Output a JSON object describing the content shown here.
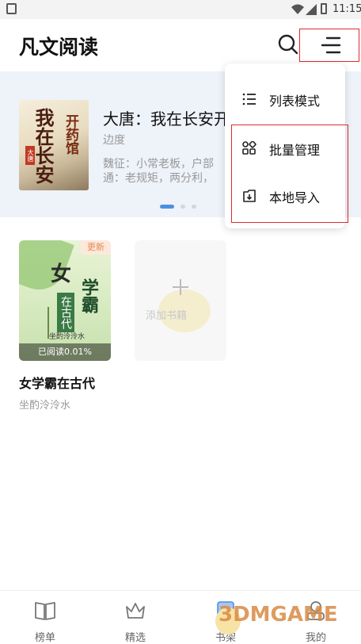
{
  "status_bar": {
    "time": "11:15"
  },
  "header": {
    "title": "凡文阅读"
  },
  "banner": {
    "title": "大唐：我在长安开",
    "author": "边度",
    "description": "魏征：小常老板，户部通：老规矩，两分利，",
    "cover": {
      "title": "我在长安",
      "subtitle": "开药馆",
      "seal": "大唐"
    }
  },
  "bookshelf": {
    "books": [
      {
        "title": "女学霸在古代",
        "author": "坐酌泠泠水",
        "badge": "更新",
        "progress": "已阅读0.01%",
        "cover": {
          "title_a": "女",
          "title_b": "学霸",
          "title_c": "在古代",
          "author": "坐酌泠泠水"
        }
      }
    ],
    "add_card": {
      "watermark": "添加书籍"
    }
  },
  "menu_popup": {
    "items": [
      {
        "label": "列表模式",
        "icon": "list-icon"
      },
      {
        "label": "批量管理",
        "icon": "grid-manage-icon"
      },
      {
        "label": "本地导入",
        "icon": "import-icon"
      }
    ]
  },
  "tabbar": {
    "tabs": [
      {
        "label": "榜单",
        "icon": "book-open-icon"
      },
      {
        "label": "精选",
        "icon": "crown-icon"
      },
      {
        "label": "书架",
        "icon": "bookshelf-icon"
      },
      {
        "label": "我的",
        "icon": "profile-icon"
      }
    ]
  },
  "watermark": {
    "text": "3DMGAME"
  },
  "colors": {
    "accent": "#4a90e2",
    "highlight_border": "#e02b2b",
    "banner_bg": "#eef2f9"
  }
}
